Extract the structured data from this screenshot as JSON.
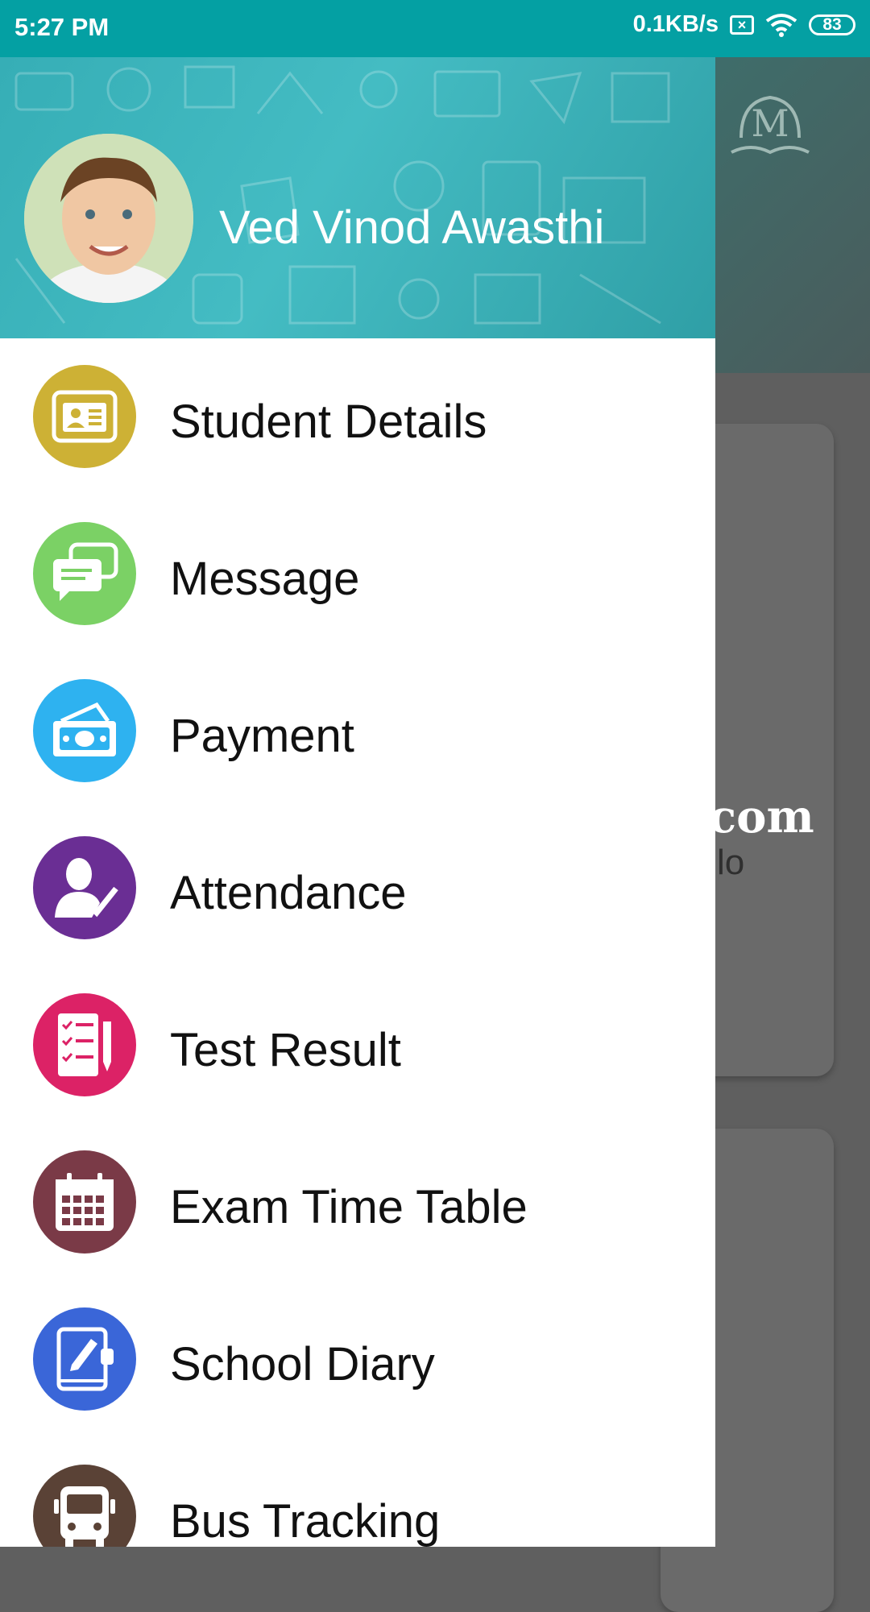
{
  "status_bar": {
    "time": "5:27 PM",
    "network_speed": "0.1KB/s",
    "battery": "83"
  },
  "drawer": {
    "user_name": "Ved Vinod Awasthi",
    "menu": [
      {
        "label": "Student Details",
        "icon": "id-card-icon",
        "color": "#cdb135"
      },
      {
        "label": "Message",
        "icon": "chat-bubbles-icon",
        "color": "#7bd165"
      },
      {
        "label": "Payment",
        "icon": "money-icon",
        "color": "#2eb2f0"
      },
      {
        "label": "Attendance",
        "icon": "person-check-icon",
        "color": "#6a2e94"
      },
      {
        "label": "Test Result",
        "icon": "checklist-icon",
        "color": "#dc2266"
      },
      {
        "label": "Exam Time Table",
        "icon": "calendar-icon",
        "color": "#7a3a47"
      },
      {
        "label": "School Diary",
        "icon": "diary-pen-icon",
        "color": "#3a66d8"
      },
      {
        "label": "Bus Tracking",
        "icon": "bus-icon",
        "color": "#5a4236"
      }
    ]
  },
  "background": {
    "text_large": "com",
    "text_small": "lo"
  },
  "colors": {
    "status_bar": "#04a0a3",
    "header": "#3db5bc"
  }
}
